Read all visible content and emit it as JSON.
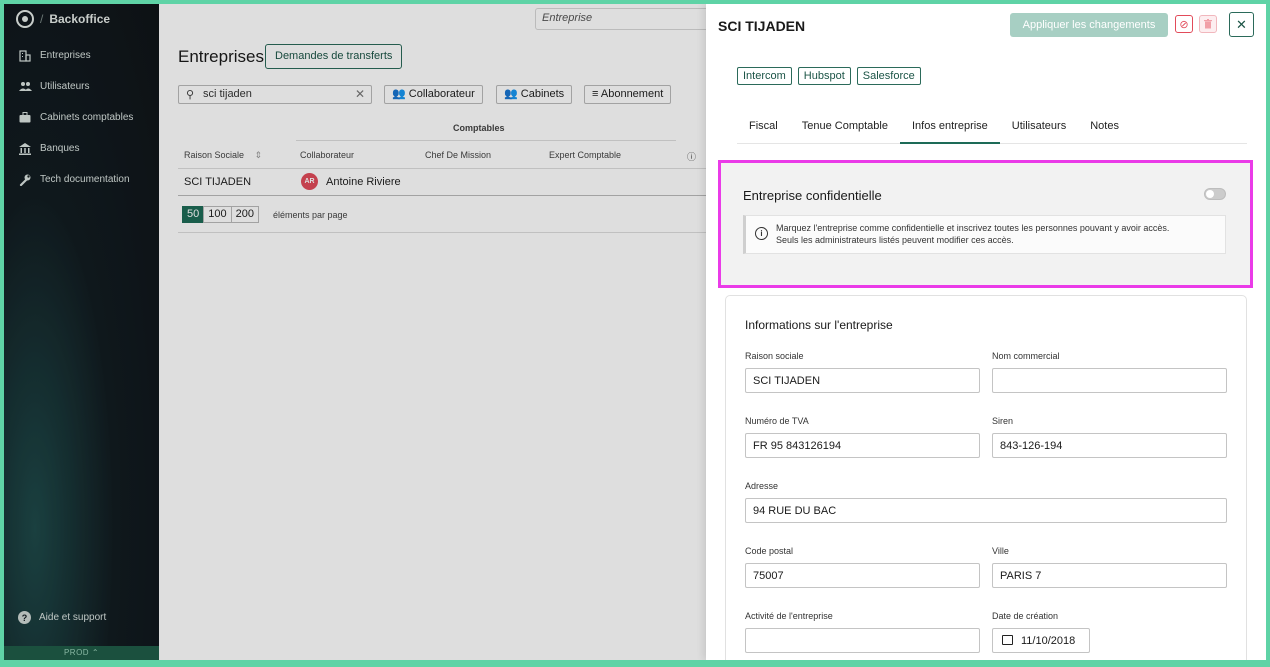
{
  "sidebar": {
    "brand": "Backoffice",
    "items": [
      {
        "label": "Entreprises",
        "icon": "building-icon"
      },
      {
        "label": "Utilisateurs",
        "icon": "users-icon"
      },
      {
        "label": "Cabinets comptables",
        "icon": "briefcase-icon"
      },
      {
        "label": "Banques",
        "icon": "bank-icon"
      },
      {
        "label": "Tech documentation",
        "icon": "wrench-icon"
      }
    ],
    "help": "Aide et support",
    "env": "PROD"
  },
  "main": {
    "top_search": "Entreprise",
    "title": "Entreprises",
    "transfer_button": "Demandes de transferts",
    "filter_value": "sci tijaden",
    "filters": {
      "collaborateur": "Collaborateur",
      "cabinets": "Cabinets",
      "abonnement": "Abonnement"
    },
    "table": {
      "group_header": "Comptables",
      "headers": {
        "raison": "Raison Sociale",
        "collab": "Collaborateur",
        "chef": "Chef De Mission",
        "expert": "Expert Comptable"
      },
      "row": {
        "raison": "SCI TIJADEN",
        "avatar": "AR",
        "collab": "Antoine Riviere"
      }
    },
    "pager": {
      "sizes": [
        "50",
        "100",
        "200"
      ],
      "label": "éléments par page"
    }
  },
  "drawer": {
    "title": "SCI TIJADEN",
    "apply_button": "Appliquer les changements",
    "tags": [
      "Intercom",
      "Hubspot",
      "Salesforce"
    ],
    "tabs": [
      "Fiscal",
      "Tenue Comptable",
      "Infos entreprise",
      "Utilisateurs",
      "Notes"
    ],
    "active_tab": "Infos entreprise",
    "confidential": {
      "title": "Entreprise confidentielle",
      "toggle_on": false,
      "info_line1": "Marquez l'entreprise comme confidentielle et inscrivez toutes les personnes pouvant y avoir accès.",
      "info_line2": "Seuls les administrateurs listés peuvent modifier ces accès."
    },
    "company": {
      "title": "Informations sur l'entreprise",
      "raison_label": "Raison sociale",
      "raison_value": "SCI TIJADEN",
      "nom_label": "Nom commercial",
      "nom_value": "",
      "tva_label": "Numéro de TVA",
      "tva_value": "FR 95 843126194",
      "siren_label": "Siren",
      "siren_value": "843-126-194",
      "adresse_label": "Adresse",
      "adresse_value": "94 RUE DU BAC",
      "cp_label": "Code postal",
      "cp_value": "75007",
      "ville_label": "Ville",
      "ville_value": "PARIS 7",
      "activite_label": "Activité de l'entreprise",
      "activite_value": "",
      "date_label": "Date de création",
      "date_value": "11/10/2018"
    }
  },
  "colors": {
    "accent": "#1d6b57",
    "highlight": "#ea3be8",
    "danger": "#e24b5a"
  }
}
